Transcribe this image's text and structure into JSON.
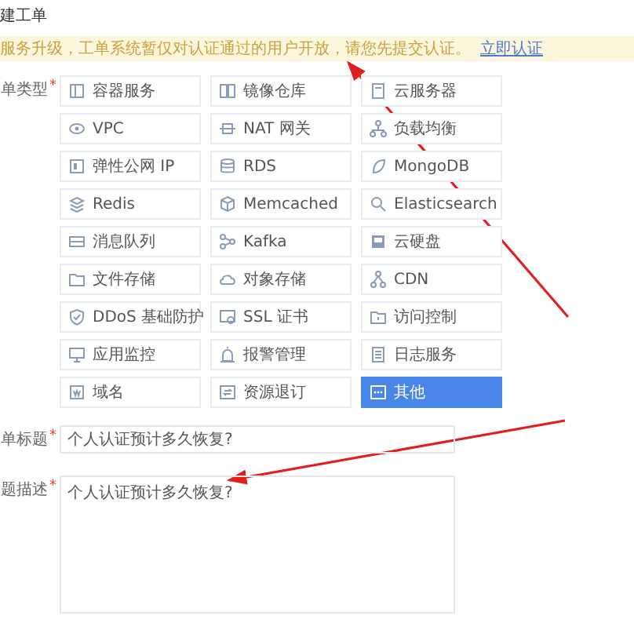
{
  "page_title": "建工单",
  "notice": {
    "text": "服务升级，工单系统暂仅对认证通过的用户开放，请您先提交认证。",
    "link": "立即认证"
  },
  "type_field": {
    "label": "单类型",
    "required_mark": "*"
  },
  "types": [
    {
      "label": "容器服务",
      "selected": false
    },
    {
      "label": "镜像仓库",
      "selected": false
    },
    {
      "label": "云服务器",
      "selected": false
    },
    {
      "label": "VPC",
      "selected": false
    },
    {
      "label": "NAT 网关",
      "selected": false
    },
    {
      "label": "负载均衡",
      "selected": false
    },
    {
      "label": "弹性公网 IP",
      "selected": false
    },
    {
      "label": "RDS",
      "selected": false
    },
    {
      "label": "MongoDB",
      "selected": false
    },
    {
      "label": "Redis",
      "selected": false
    },
    {
      "label": "Memcached",
      "selected": false
    },
    {
      "label": "Elasticsearch",
      "selected": false
    },
    {
      "label": "消息队列",
      "selected": false
    },
    {
      "label": "Kafka",
      "selected": false
    },
    {
      "label": "云硬盘",
      "selected": false
    },
    {
      "label": "文件存储",
      "selected": false
    },
    {
      "label": "对象存储",
      "selected": false
    },
    {
      "label": "CDN",
      "selected": false
    },
    {
      "label": "DDoS 基础防护",
      "selected": false
    },
    {
      "label": "SSL 证书",
      "selected": false
    },
    {
      "label": "访问控制",
      "selected": false
    },
    {
      "label": "应用监控",
      "selected": false
    },
    {
      "label": "报警管理",
      "selected": false
    },
    {
      "label": "日志服务",
      "selected": false
    },
    {
      "label": "域名",
      "selected": false
    },
    {
      "label": "资源退订",
      "selected": false
    },
    {
      "label": "其他",
      "selected": true
    }
  ],
  "title_field": {
    "label": "单标题",
    "required_mark": "*",
    "value": "个人认证预计多久恢复?"
  },
  "description_field": {
    "label": "题描述",
    "required_mark": "*",
    "value": "个人认证预计多久恢复?"
  }
}
